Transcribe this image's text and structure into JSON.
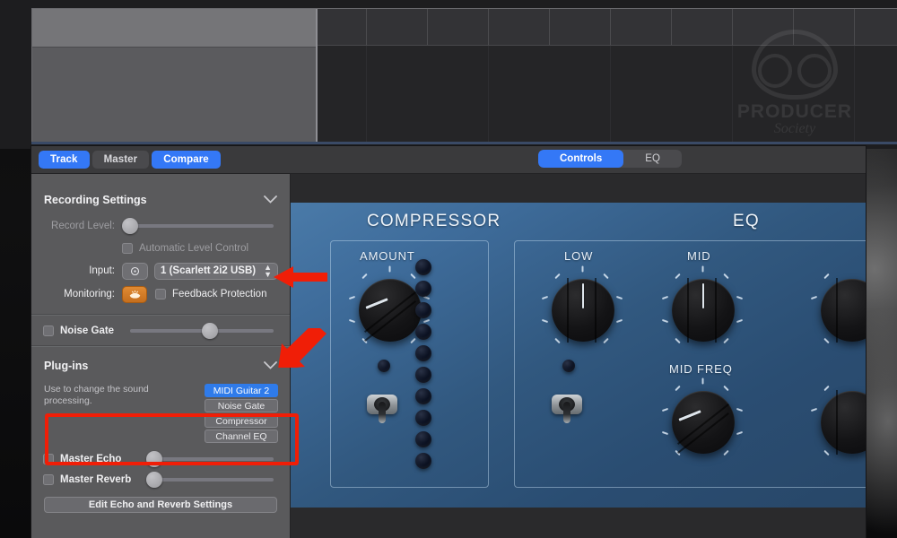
{
  "window": {
    "toolbar": {
      "tabs": [
        {
          "label": "Track",
          "state": "selected"
        },
        {
          "label": "Master",
          "state": "normal"
        },
        {
          "label": "Compare",
          "state": "selected"
        }
      ],
      "view_switch": [
        {
          "label": "Controls",
          "state": "selected"
        },
        {
          "label": "EQ",
          "state": "normal"
        }
      ]
    },
    "sidebar": {
      "recording": {
        "title": "Recording Settings",
        "chevron_icon": "chevron-down-icon",
        "record_level_label": "Record Level:",
        "record_level_value": 0,
        "automatic_level_control_label": "Automatic Level Control",
        "automatic_level_control_checked": false,
        "input_label": "Input:",
        "input_mono_icon": "mono-input-icon",
        "input_device": "1  (Scarlett 2i2 USB)",
        "monitoring_label": "Monitoring:",
        "monitoring_icon": "monitor-speaker-icon",
        "feedback_protection_label": "Feedback Protection",
        "feedback_protection_checked": false,
        "noise_gate_label": "Noise Gate",
        "noise_gate_checked": false,
        "noise_gate_value": 52
      },
      "plugins": {
        "title": "Plug-ins",
        "chevron_icon": "chevron-down-icon",
        "help_text": "Use to change the sound processing.",
        "list": [
          {
            "label": "MIDI Guitar 2",
            "selected": true
          },
          {
            "label": "Noise Gate",
            "selected": false
          },
          {
            "label": "Compressor",
            "selected": false
          },
          {
            "label": "Channel EQ",
            "selected": false
          }
        ],
        "master_echo_label": "Master Echo",
        "master_echo_checked": false,
        "master_echo_value": 0,
        "master_reverb_label": "Master Reverb",
        "master_reverb_checked": false,
        "master_reverb_value": 0,
        "edit_button_label": "Edit Echo and Reverb Settings"
      }
    },
    "amp": {
      "sections": [
        {
          "title": "COMPRESSOR",
          "knobs": [
            {
              "label": "AMOUNT",
              "angle": 300
            }
          ],
          "led_count": 10,
          "has_toggle": true
        },
        {
          "title": "EQ",
          "knobs": [
            {
              "label": "LOW",
              "angle": 0
            },
            {
              "label": "MID",
              "angle": 0
            },
            {
              "label": "MID FREQ",
              "angle": 305
            }
          ],
          "has_toggle": true
        }
      ]
    }
  },
  "watermark": {
    "line1": "PRODUCER",
    "line2": "Society",
    "icon": "speaker-cabinet-icon"
  },
  "annotations": {
    "accent_color": "#f01e07",
    "arrow_feedback_protection": "arrow-left-icon",
    "arrow_plugin_list": "arrow-down-left-icon",
    "box_master_echo_reverb": "highlight-box"
  }
}
